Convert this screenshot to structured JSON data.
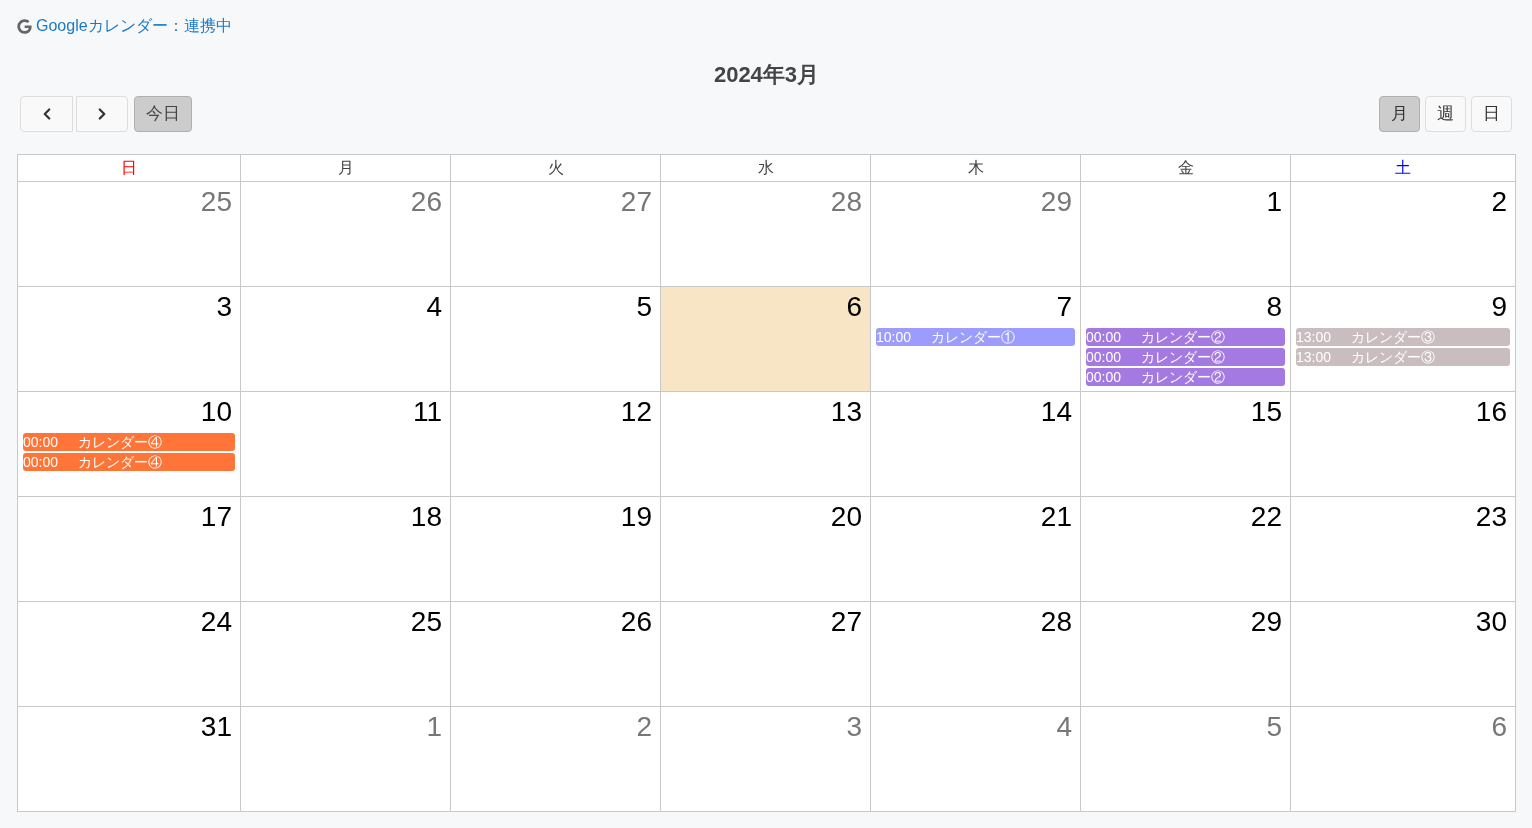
{
  "header": {
    "link": {
      "label": "Googleカレンダー：連携中"
    }
  },
  "calendar": {
    "title": "2024年3月",
    "today_button": {
      "label": "今日",
      "disabled": true
    },
    "views": [
      {
        "label": "月",
        "selected": true
      },
      {
        "label": "週",
        "selected": false
      },
      {
        "label": "日",
        "selected": false
      }
    ],
    "weekdays": [
      {
        "label": "日",
        "color": "#ff0000"
      },
      {
        "label": "月",
        "color": "#444444"
      },
      {
        "label": "火",
        "color": "#444444"
      },
      {
        "label": "水",
        "color": "#444444"
      },
      {
        "label": "木",
        "color": "#444444"
      },
      {
        "label": "金",
        "color": "#444444"
      },
      {
        "label": "土",
        "color": "#0000ff"
      }
    ],
    "weeks": [
      {
        "days": [
          {
            "date": "25",
            "other_month": true,
            "today": false
          },
          {
            "date": "26",
            "other_month": true,
            "today": false
          },
          {
            "date": "27",
            "other_month": true,
            "today": false
          },
          {
            "date": "28",
            "other_month": true,
            "today": false
          },
          {
            "date": "29",
            "other_month": true,
            "today": false
          },
          {
            "date": "1",
            "other_month": false,
            "today": false
          },
          {
            "date": "2",
            "other_month": false,
            "today": false
          }
        ]
      },
      {
        "days": [
          {
            "date": "3",
            "other_month": false,
            "today": false
          },
          {
            "date": "4",
            "other_month": false,
            "today": false
          },
          {
            "date": "5",
            "other_month": false,
            "today": false
          },
          {
            "date": "6",
            "other_month": false,
            "today": true
          },
          {
            "date": "7",
            "other_month": false,
            "today": false,
            "events": [
              {
                "time": "10:00",
                "title": "カレンダー①",
                "color": "#9c9cfc"
              }
            ]
          },
          {
            "date": "8",
            "other_month": false,
            "today": false,
            "events": [
              {
                "time": "00:00",
                "title": "カレンダー②",
                "color": "#a47ae2"
              },
              {
                "time": "00:00",
                "title": "カレンダー②",
                "color": "#a47ae2"
              },
              {
                "time": "00:00",
                "title": "カレンダー②",
                "color": "#a47ae2"
              }
            ]
          },
          {
            "date": "9",
            "other_month": false,
            "today": false,
            "events": [
              {
                "time": "13:00",
                "title": "カレンダー③",
                "color": "#cabdbf"
              },
              {
                "time": "13:00",
                "title": "カレンダー③",
                "color": "#cabdbf"
              }
            ]
          }
        ]
      },
      {
        "days": [
          {
            "date": "10",
            "other_month": false,
            "today": false,
            "events": [
              {
                "time": "00:00",
                "title": "カレンダー④",
                "color": "#ff7537"
              },
              {
                "time": "00:00",
                "title": "カレンダー④",
                "color": "#ff7537"
              }
            ]
          },
          {
            "date": "11",
            "other_month": false,
            "today": false
          },
          {
            "date": "12",
            "other_month": false,
            "today": false
          },
          {
            "date": "13",
            "other_month": false,
            "today": false
          },
          {
            "date": "14",
            "other_month": false,
            "today": false
          },
          {
            "date": "15",
            "other_month": false,
            "today": false
          },
          {
            "date": "16",
            "other_month": false,
            "today": false
          }
        ]
      },
      {
        "days": [
          {
            "date": "17",
            "other_month": false,
            "today": false
          },
          {
            "date": "18",
            "other_month": false,
            "today": false
          },
          {
            "date": "19",
            "other_month": false,
            "today": false
          },
          {
            "date": "20",
            "other_month": false,
            "today": false
          },
          {
            "date": "21",
            "other_month": false,
            "today": false
          },
          {
            "date": "22",
            "other_month": false,
            "today": false
          },
          {
            "date": "23",
            "other_month": false,
            "today": false
          }
        ]
      },
      {
        "days": [
          {
            "date": "24",
            "other_month": false,
            "today": false
          },
          {
            "date": "25",
            "other_month": false,
            "today": false
          },
          {
            "date": "26",
            "other_month": false,
            "today": false
          },
          {
            "date": "27",
            "other_month": false,
            "today": false
          },
          {
            "date": "28",
            "other_month": false,
            "today": false
          },
          {
            "date": "29",
            "other_month": false,
            "today": false
          },
          {
            "date": "30",
            "other_month": false,
            "today": false
          }
        ]
      },
      {
        "days": [
          {
            "date": "31",
            "other_month": false,
            "today": false
          },
          {
            "date": "1",
            "other_month": true,
            "today": false
          },
          {
            "date": "2",
            "other_month": true,
            "today": false
          },
          {
            "date": "3",
            "other_month": true,
            "today": false
          },
          {
            "date": "4",
            "other_month": true,
            "today": false
          },
          {
            "date": "5",
            "other_month": true,
            "today": false
          },
          {
            "date": "6",
            "other_month": true,
            "today": false
          }
        ]
      }
    ]
  }
}
